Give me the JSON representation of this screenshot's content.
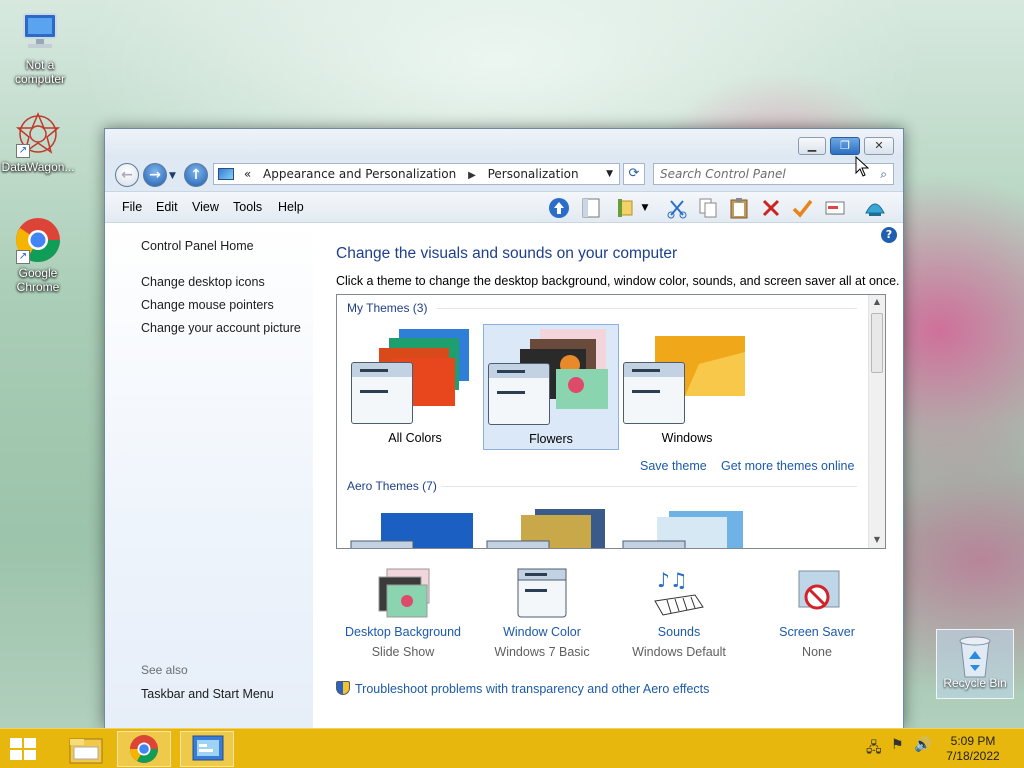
{
  "desktop": {
    "icons": [
      {
        "label": "Not a computer"
      },
      {
        "label": "DataWagon..."
      },
      {
        "label": "Google Chrome"
      }
    ],
    "recycle_bin_label": "Recycle Bin"
  },
  "window": {
    "address": {
      "chevron": "«",
      "crumbs": [
        "Appearance and Personalization",
        "Personalization"
      ]
    },
    "search_placeholder": "Search Control Panel",
    "menu": [
      "File",
      "Edit",
      "View",
      "Tools",
      "Help"
    ],
    "left_pane": {
      "links": [
        "Control Panel Home",
        "Change desktop icons",
        "Change mouse pointers",
        "Change your account picture"
      ],
      "see_also_label": "See also",
      "see_also_links": [
        "Taskbar and Start Menu"
      ]
    },
    "main": {
      "title": "Change the visuals and sounds on your computer",
      "subtitle": "Click a theme to change the desktop background, window color, sounds, and screen saver all at once.",
      "groups": [
        {
          "label": "My Themes (3)",
          "themes": [
            "All Colors",
            "Flowers",
            "Windows"
          ],
          "selected": "Flowers"
        },
        {
          "label": "Aero Themes (7)"
        }
      ],
      "save_theme": "Save theme",
      "get_more": "Get more themes online",
      "settings": [
        {
          "label": "Desktop Background",
          "value": "Slide Show"
        },
        {
          "label": "Window Color",
          "value": "Windows 7 Basic"
        },
        {
          "label": "Sounds",
          "value": "Windows Default"
        },
        {
          "label": "Screen Saver",
          "value": "None"
        }
      ],
      "troubleshoot": "Troubleshoot problems with transparency and other Aero effects"
    }
  },
  "taskbar": {
    "time": "5:09 PM",
    "date": "7/18/2022",
    "color": "#e8b70e"
  }
}
